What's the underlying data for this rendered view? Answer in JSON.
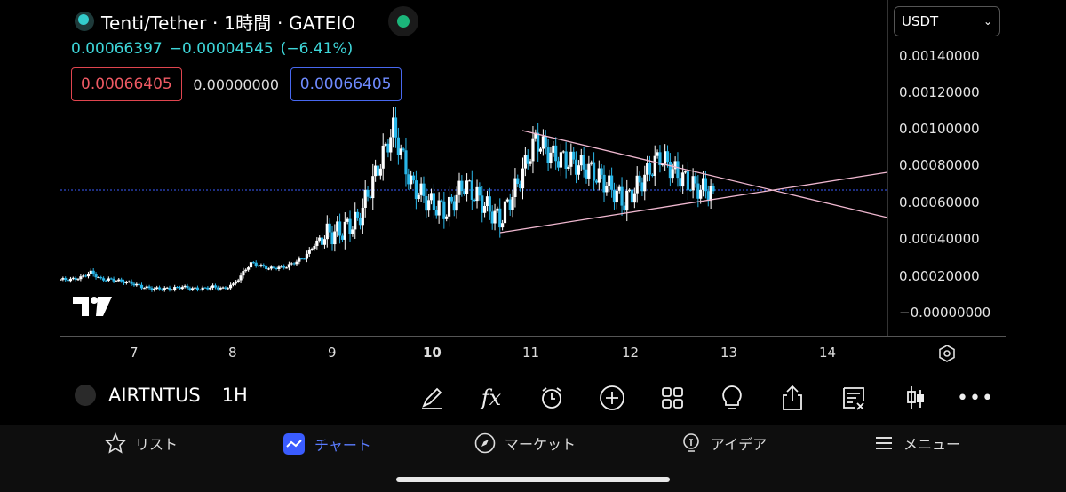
{
  "header": {
    "title": "Tenti/Tether · 1時間 · GATEIO",
    "price": "0.00066397",
    "change": "−0.00004545",
    "change_pct": "(−6.41%)",
    "sell_price": "0.00066405",
    "spread": "0.00000000",
    "buy_price": "0.00066405"
  },
  "price_axis": {
    "currency": "USDT",
    "ticks": [
      "0.00140000",
      "0.00120000",
      "0.00100000",
      "0.00080000",
      "0.00060000",
      "0.00040000",
      "0.00020000",
      "−0.00000000"
    ]
  },
  "time_axis": {
    "ticks": [
      "7",
      "8",
      "9",
      "10",
      "11",
      "12",
      "13",
      "14"
    ]
  },
  "toolbar": {
    "symbol": "AIRTNTUS",
    "interval": "1H"
  },
  "nav": {
    "list": "リスト",
    "chart": "チャート",
    "market": "マーケット",
    "ideas": "アイデア",
    "menu": "メニュー"
  },
  "colors": {
    "up": "#ffffff",
    "down": "#29b6e8",
    "trendline": "#f0b8d0",
    "price_line": "#3a5cff",
    "accent": "#5a7cff"
  },
  "chart_data": {
    "type": "candlestick",
    "x_label_days": [
      "7",
      "8",
      "9",
      "10",
      "11",
      "12",
      "13",
      "14"
    ],
    "ylim": [
      0,
      0.0015
    ],
    "last_price": 0.00066397,
    "series_approx_close": [
      0.00018,
      0.00018,
      0.00019,
      0.00022,
      0.00018,
      0.00018,
      0.00017,
      0.00016,
      0.00014,
      0.00013,
      0.00013,
      0.00013,
      0.00014,
      0.00013,
      0.00013,
      0.00014,
      0.00013,
      0.00015,
      0.00027,
      0.00024,
      0.00025,
      0.0003,
      0.00042,
      0.00044,
      0.0005,
      0.00075,
      0.001,
      0.0007,
      0.0006,
      0.00055,
      0.0007,
      0.0006,
      0.0005,
      0.0007,
      0.00094,
      0.00085,
      0.00082,
      0.00078,
      0.0007,
      0.0006,
      0.00072,
      0.00085,
      0.00075,
      0.00068,
      0.00066
    ]
  }
}
